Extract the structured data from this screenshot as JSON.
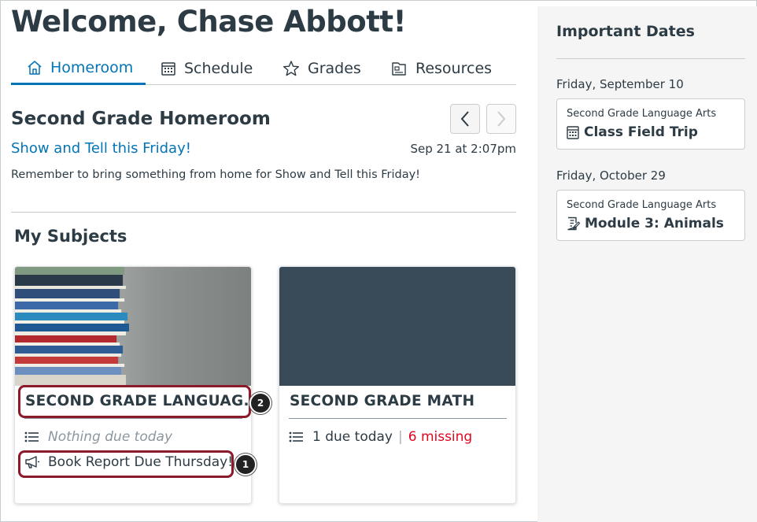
{
  "header": {
    "welcome": "Welcome, Chase Abbott!"
  },
  "tabs": [
    {
      "label": "Homeroom",
      "icon": "home-icon",
      "active": true
    },
    {
      "label": "Schedule",
      "icon": "calendar-icon",
      "active": false
    },
    {
      "label": "Grades",
      "icon": "star-icon",
      "active": false
    },
    {
      "label": "Resources",
      "icon": "resources-icon",
      "active": false
    }
  ],
  "homeroom": {
    "title": "Second Grade Homeroom",
    "announcement_title": "Show and Tell this Friday!",
    "announcement_date": "Sep 21 at 2:07pm",
    "announcement_body": "Remember to bring something from home for Show and Tell this Friday!"
  },
  "subjects": {
    "heading": "My Subjects",
    "cards": [
      {
        "title": "SECOND GRADE LANGUAG...",
        "due_text": "Nothing due today",
        "announcement": "Book Report Due Thursday!",
        "color": "#3b4a58"
      },
      {
        "title": "SECOND GRADE MATH",
        "due_text": "1 due today",
        "separator": "|",
        "missing_text": "6 missing",
        "color": "#394b58"
      }
    ]
  },
  "callouts": {
    "badge_1": "1",
    "badge_2": "2"
  },
  "sidebar": {
    "title": "Important Dates",
    "groups": [
      {
        "date": "Friday, September 10",
        "course": "Second Grade Language Arts",
        "item": "Class Field Trip",
        "icon": "calendar-icon"
      },
      {
        "date": "Friday, October 29",
        "course": "Second Grade Language Arts",
        "item": "Module 3: Animals",
        "icon": "assignment-icon"
      }
    ]
  },
  "colors": {
    "accent": "#0374b5",
    "missing": "#e0061f",
    "text": "#2d3b45",
    "callout": "#8b1a2b"
  }
}
